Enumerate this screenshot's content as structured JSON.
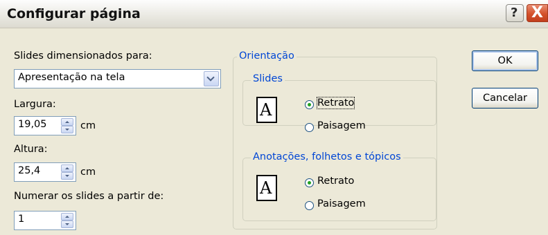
{
  "dialog": {
    "title": "Configurar página",
    "help_label": "?",
    "close_label": "X"
  },
  "left": {
    "slides_size_label": "Slides dimensionados para:",
    "slides_size_value": "Apresentação na tela",
    "width_label": "Largura:",
    "width_value": "19,05",
    "width_unit": "cm",
    "height_label": "Altura:",
    "height_value": "25,4",
    "height_unit": "cm",
    "number_from_label": "Numerar os slides a partir de:",
    "number_from_value": "1"
  },
  "orientation": {
    "title": "Orientação",
    "slides_group": {
      "title": "Slides",
      "icon_letter": "A",
      "portrait_label": "Retrato",
      "landscape_label": "Paisagem",
      "selected": "portrait"
    },
    "notes_group": {
      "title": "Anotações, folhetos e  tópicos",
      "icon_letter": "A",
      "portrait_label": "Retrato",
      "landscape_label": "Paisagem",
      "selected": "portrait"
    }
  },
  "buttons": {
    "ok_label": "OK",
    "cancel_label": "Cancelar"
  }
}
